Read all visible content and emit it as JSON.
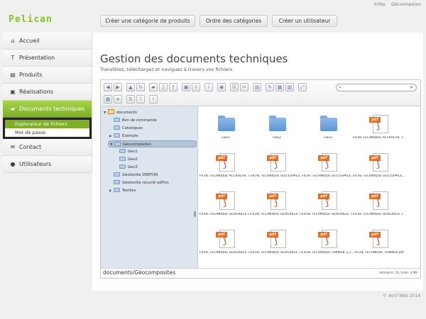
{
  "top_links": {
    "infos": "Infos",
    "logout": "Déconnexion"
  },
  "logo": "Pelican",
  "header_buttons": {
    "create_category": "Créer une catégorie de produits",
    "order_categories": "Ordre des catégories",
    "create_user": "Créer un utilisateur"
  },
  "sidebar": {
    "items": [
      {
        "label": "Accueil",
        "icon": "home-icon"
      },
      {
        "label": "Présentation",
        "icon": "text-icon"
      },
      {
        "label": "Produits",
        "icon": "list-icon"
      },
      {
        "label": "Réalisations",
        "icon": "briefcase-icon"
      },
      {
        "label": "Documents techniques",
        "icon": "folder-icon",
        "active": true
      },
      {
        "label": "Contact",
        "icon": "mail-icon"
      },
      {
        "label": "Utilisateurs",
        "icon": "user-icon"
      }
    ],
    "sub_items": [
      "Explorateur de fichiers",
      "Mot de passe"
    ]
  },
  "main": {
    "title": "Gestion des documents techniques",
    "subtitle": "Transférez, téléchargez et naviguez à travers vos fichiers."
  },
  "file_manager": {
    "tree": {
      "root": "documents",
      "nodes": [
        "Bon de commande",
        "Catalogues",
        "Exemple",
        "Géocomposites",
        "Geo1",
        "Geo2",
        "Geo3",
        "Géotextile DREFON",
        "Géotextile recyclé ediFon",
        "Textiles"
      ]
    },
    "files": [
      {
        "name": "Geo1",
        "type": "folder"
      },
      {
        "name": "Geo2",
        "type": "folder"
      },
      {
        "name": "Geo3",
        "type": "folder"
      },
      {
        "name": "FICHE TECHNIQUE ACCROCHE T...",
        "type": "pdf"
      },
      {
        "name": "FICHE TECHNIQUE ACCROCHE T...",
        "type": "pdf"
      },
      {
        "name": "FICHE TECHNIQUE GEO ESPACE...",
        "type": "pdf"
      },
      {
        "name": "FICHE TECHNIQUE GEO ESPACE...",
        "type": "pdf"
      },
      {
        "name": "FICHE TECHNIQUE GEO ESPACE...",
        "type": "pdf"
      },
      {
        "name": "FICHE TECHNIQUE GEOGRILLE L...",
        "type": "pdf"
      },
      {
        "name": "FICHE TECHNIQUE GEOGRILLE T...",
        "type": "pdf"
      },
      {
        "name": "FICHE TECHNIQUE GEOGRILLE T...",
        "type": "pdf"
      },
      {
        "name": "FICHE TECHNIQUE GEOGRILLE T...",
        "type": "pdf"
      },
      {
        "name": "FICHE TECHNIQUE GEOGRILLE T...",
        "type": "pdf"
      },
      {
        "name": "FICHE TECHNIQUE GEOGRILLE T...",
        "type": "pdf"
      },
      {
        "name": "FICHE TECHNIQUE TENWEB 3_2...",
        "type": "pdf"
      },
      {
        "name": "FICHE TECHNIQUE TENWEB.pdf",
        "type": "pdf"
      }
    ],
    "pdf_tag": "pdf",
    "path": "documents/Géocomposites",
    "stats": "éléments: 16, taille: 3 MB"
  },
  "footer": "© Avril Web 2014",
  "colors": {
    "accent": "#8cbf2f",
    "active_nav": "#7fae27",
    "folder": "#5f95d6",
    "pdf_tag": "#e0702a"
  }
}
